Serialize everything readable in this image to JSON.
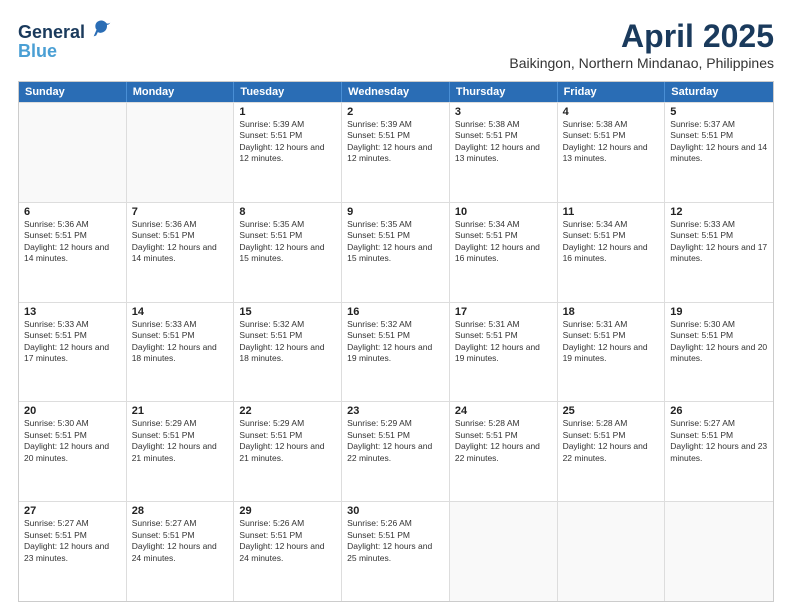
{
  "header": {
    "logo_line1": "General",
    "logo_line2": "Blue",
    "month": "April 2025",
    "location": "Baikingon, Northern Mindanao, Philippines"
  },
  "weekdays": [
    "Sunday",
    "Monday",
    "Tuesday",
    "Wednesday",
    "Thursday",
    "Friday",
    "Saturday"
  ],
  "rows": [
    [
      {
        "day": "",
        "sunrise": "",
        "sunset": "",
        "daylight": "",
        "empty": true
      },
      {
        "day": "",
        "sunrise": "",
        "sunset": "",
        "daylight": "",
        "empty": true
      },
      {
        "day": "1",
        "sunrise": "Sunrise: 5:39 AM",
        "sunset": "Sunset: 5:51 PM",
        "daylight": "Daylight: 12 hours and 12 minutes.",
        "empty": false
      },
      {
        "day": "2",
        "sunrise": "Sunrise: 5:39 AM",
        "sunset": "Sunset: 5:51 PM",
        "daylight": "Daylight: 12 hours and 12 minutes.",
        "empty": false
      },
      {
        "day": "3",
        "sunrise": "Sunrise: 5:38 AM",
        "sunset": "Sunset: 5:51 PM",
        "daylight": "Daylight: 12 hours and 13 minutes.",
        "empty": false
      },
      {
        "day": "4",
        "sunrise": "Sunrise: 5:38 AM",
        "sunset": "Sunset: 5:51 PM",
        "daylight": "Daylight: 12 hours and 13 minutes.",
        "empty": false
      },
      {
        "day": "5",
        "sunrise": "Sunrise: 5:37 AM",
        "sunset": "Sunset: 5:51 PM",
        "daylight": "Daylight: 12 hours and 14 minutes.",
        "empty": false
      }
    ],
    [
      {
        "day": "6",
        "sunrise": "Sunrise: 5:36 AM",
        "sunset": "Sunset: 5:51 PM",
        "daylight": "Daylight: 12 hours and 14 minutes.",
        "empty": false
      },
      {
        "day": "7",
        "sunrise": "Sunrise: 5:36 AM",
        "sunset": "Sunset: 5:51 PM",
        "daylight": "Daylight: 12 hours and 14 minutes.",
        "empty": false
      },
      {
        "day": "8",
        "sunrise": "Sunrise: 5:35 AM",
        "sunset": "Sunset: 5:51 PM",
        "daylight": "Daylight: 12 hours and 15 minutes.",
        "empty": false
      },
      {
        "day": "9",
        "sunrise": "Sunrise: 5:35 AM",
        "sunset": "Sunset: 5:51 PM",
        "daylight": "Daylight: 12 hours and 15 minutes.",
        "empty": false
      },
      {
        "day": "10",
        "sunrise": "Sunrise: 5:34 AM",
        "sunset": "Sunset: 5:51 PM",
        "daylight": "Daylight: 12 hours and 16 minutes.",
        "empty": false
      },
      {
        "day": "11",
        "sunrise": "Sunrise: 5:34 AM",
        "sunset": "Sunset: 5:51 PM",
        "daylight": "Daylight: 12 hours and 16 minutes.",
        "empty": false
      },
      {
        "day": "12",
        "sunrise": "Sunrise: 5:33 AM",
        "sunset": "Sunset: 5:51 PM",
        "daylight": "Daylight: 12 hours and 17 minutes.",
        "empty": false
      }
    ],
    [
      {
        "day": "13",
        "sunrise": "Sunrise: 5:33 AM",
        "sunset": "Sunset: 5:51 PM",
        "daylight": "Daylight: 12 hours and 17 minutes.",
        "empty": false
      },
      {
        "day": "14",
        "sunrise": "Sunrise: 5:33 AM",
        "sunset": "Sunset: 5:51 PM",
        "daylight": "Daylight: 12 hours and 18 minutes.",
        "empty": false
      },
      {
        "day": "15",
        "sunrise": "Sunrise: 5:32 AM",
        "sunset": "Sunset: 5:51 PM",
        "daylight": "Daylight: 12 hours and 18 minutes.",
        "empty": false
      },
      {
        "day": "16",
        "sunrise": "Sunrise: 5:32 AM",
        "sunset": "Sunset: 5:51 PM",
        "daylight": "Daylight: 12 hours and 19 minutes.",
        "empty": false
      },
      {
        "day": "17",
        "sunrise": "Sunrise: 5:31 AM",
        "sunset": "Sunset: 5:51 PM",
        "daylight": "Daylight: 12 hours and 19 minutes.",
        "empty": false
      },
      {
        "day": "18",
        "sunrise": "Sunrise: 5:31 AM",
        "sunset": "Sunset: 5:51 PM",
        "daylight": "Daylight: 12 hours and 19 minutes.",
        "empty": false
      },
      {
        "day": "19",
        "sunrise": "Sunrise: 5:30 AM",
        "sunset": "Sunset: 5:51 PM",
        "daylight": "Daylight: 12 hours and 20 minutes.",
        "empty": false
      }
    ],
    [
      {
        "day": "20",
        "sunrise": "Sunrise: 5:30 AM",
        "sunset": "Sunset: 5:51 PM",
        "daylight": "Daylight: 12 hours and 20 minutes.",
        "empty": false
      },
      {
        "day": "21",
        "sunrise": "Sunrise: 5:29 AM",
        "sunset": "Sunset: 5:51 PM",
        "daylight": "Daylight: 12 hours and 21 minutes.",
        "empty": false
      },
      {
        "day": "22",
        "sunrise": "Sunrise: 5:29 AM",
        "sunset": "Sunset: 5:51 PM",
        "daylight": "Daylight: 12 hours and 21 minutes.",
        "empty": false
      },
      {
        "day": "23",
        "sunrise": "Sunrise: 5:29 AM",
        "sunset": "Sunset: 5:51 PM",
        "daylight": "Daylight: 12 hours and 22 minutes.",
        "empty": false
      },
      {
        "day": "24",
        "sunrise": "Sunrise: 5:28 AM",
        "sunset": "Sunset: 5:51 PM",
        "daylight": "Daylight: 12 hours and 22 minutes.",
        "empty": false
      },
      {
        "day": "25",
        "sunrise": "Sunrise: 5:28 AM",
        "sunset": "Sunset: 5:51 PM",
        "daylight": "Daylight: 12 hours and 22 minutes.",
        "empty": false
      },
      {
        "day": "26",
        "sunrise": "Sunrise: 5:27 AM",
        "sunset": "Sunset: 5:51 PM",
        "daylight": "Daylight: 12 hours and 23 minutes.",
        "empty": false
      }
    ],
    [
      {
        "day": "27",
        "sunrise": "Sunrise: 5:27 AM",
        "sunset": "Sunset: 5:51 PM",
        "daylight": "Daylight: 12 hours and 23 minutes.",
        "empty": false
      },
      {
        "day": "28",
        "sunrise": "Sunrise: 5:27 AM",
        "sunset": "Sunset: 5:51 PM",
        "daylight": "Daylight: 12 hours and 24 minutes.",
        "empty": false
      },
      {
        "day": "29",
        "sunrise": "Sunrise: 5:26 AM",
        "sunset": "Sunset: 5:51 PM",
        "daylight": "Daylight: 12 hours and 24 minutes.",
        "empty": false
      },
      {
        "day": "30",
        "sunrise": "Sunrise: 5:26 AM",
        "sunset": "Sunset: 5:51 PM",
        "daylight": "Daylight: 12 hours and 25 minutes.",
        "empty": false
      },
      {
        "day": "",
        "sunrise": "",
        "sunset": "",
        "daylight": "",
        "empty": true
      },
      {
        "day": "",
        "sunrise": "",
        "sunset": "",
        "daylight": "",
        "empty": true
      },
      {
        "day": "",
        "sunrise": "",
        "sunset": "",
        "daylight": "",
        "empty": true
      }
    ]
  ]
}
